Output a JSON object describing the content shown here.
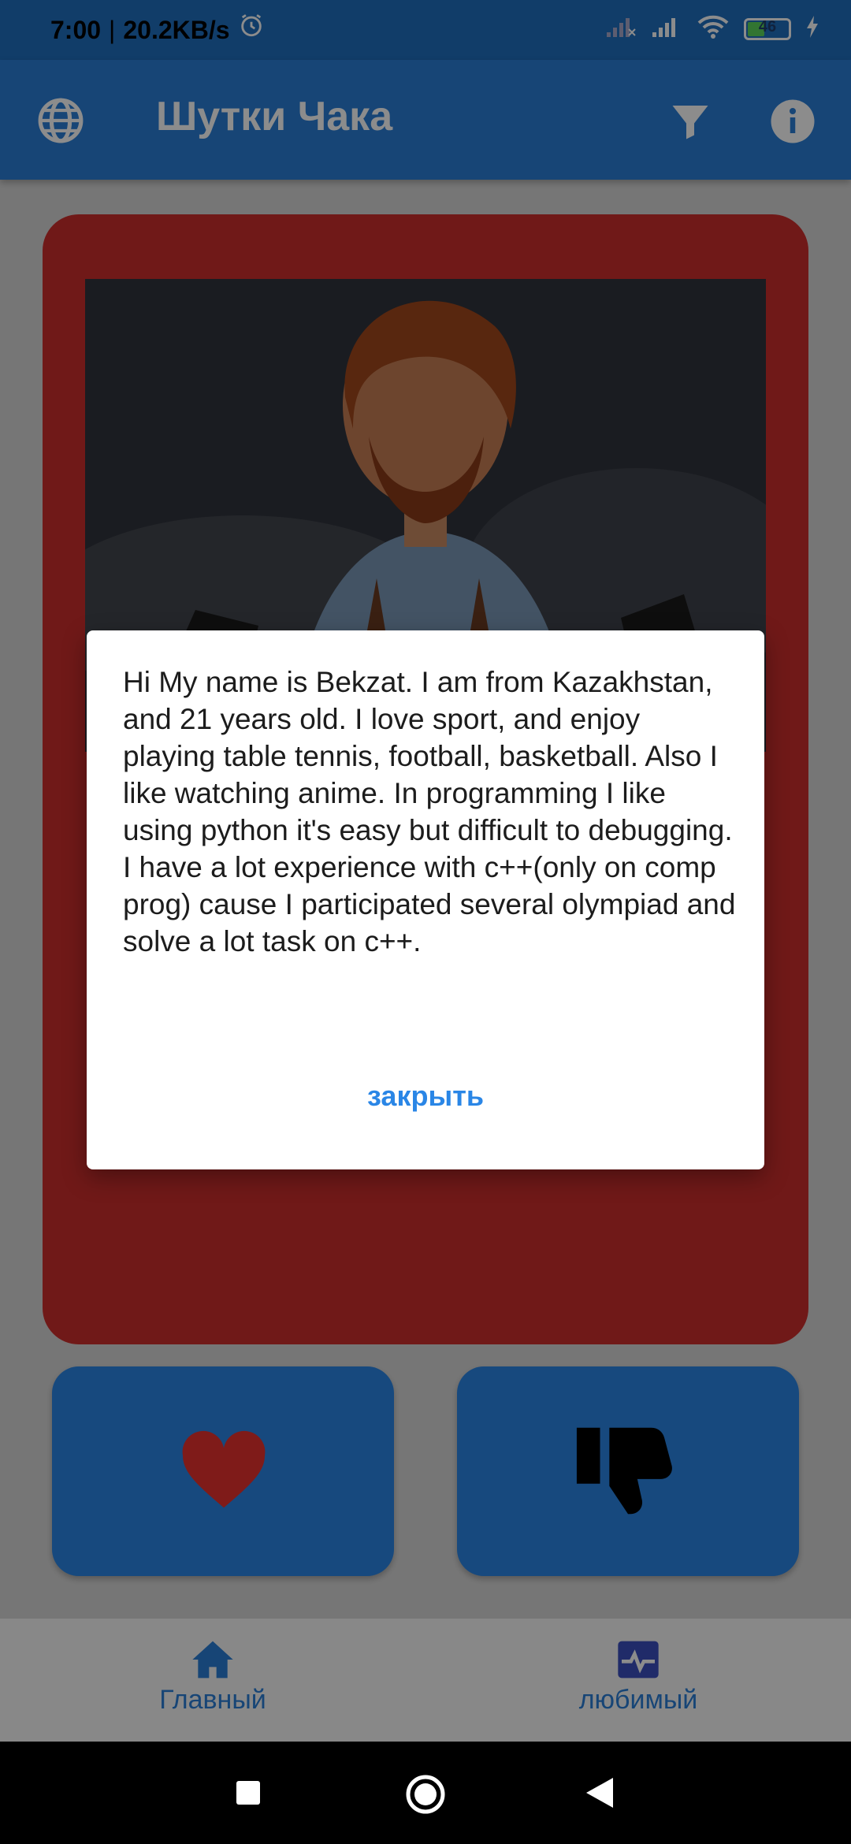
{
  "status_bar": {
    "time": "7:00",
    "separator": "|",
    "speed": "20.2KB/s",
    "battery_level": "46",
    "icons": [
      "alarm-icon",
      "signal-no-service-icon",
      "signal-icon",
      "wifi-icon",
      "battery-icon",
      "charging-icon"
    ]
  },
  "app_bar": {
    "title": "Шутки Чака",
    "icons": [
      "globe-icon",
      "filter-icon",
      "info-icon"
    ]
  },
  "dialog": {
    "text": "Hi My name is Bekzat. I am from Kazakhstan, and 21 years old. I love sport, and enjoy playing table tennis, football, basketball. Also I like watching anime. In programming I like using python it's easy but difficult to debugging. I have a lot experience with c++(only on comp prog) cause I participated several olympiad and solve a lot task on c++.",
    "close_label": "закрыть"
  },
  "actions": {
    "icons": [
      "heart-icon",
      "thumbs-down-icon"
    ]
  },
  "bottom_nav": {
    "items": [
      {
        "label": "Главный",
        "icon": "home-icon"
      },
      {
        "label": "любимый",
        "icon": "favorites-icon"
      }
    ]
  },
  "colors": {
    "primary": "#2a7fd8",
    "card": "#cc2f2c",
    "button": "#2a86e6",
    "accent_text": "#2a86e6"
  }
}
